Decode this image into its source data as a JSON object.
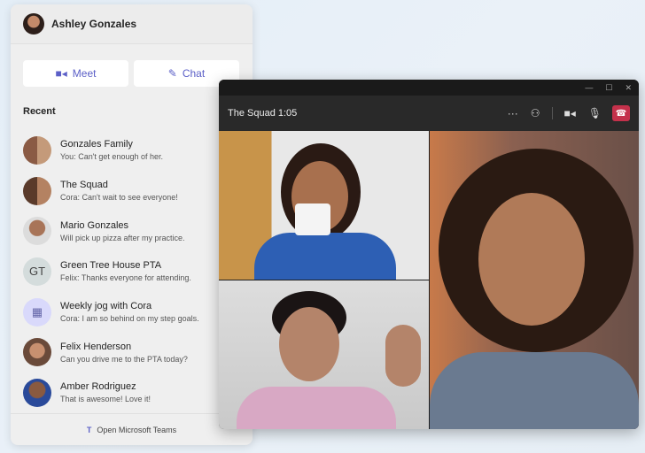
{
  "user": {
    "name": "Ashley Gonzales"
  },
  "actions": {
    "meet": "Meet",
    "chat": "Chat"
  },
  "recent_label": "Recent",
  "chats": [
    {
      "name": "Gonzales Family",
      "msg": "You: Can't get enough of her."
    },
    {
      "name": "The Squad",
      "msg": "Cora: Can't wait to see everyone!"
    },
    {
      "name": "Mario Gonzales",
      "msg": "Will pick up pizza after my practice."
    },
    {
      "name": "Green Tree House PTA",
      "msg": "Felix: Thanks everyone for attending.",
      "initials": "GT"
    },
    {
      "name": "Weekly jog with Cora",
      "msg": "Cora: I am so behind on my step goals."
    },
    {
      "name": "Felix Henderson",
      "msg": "Can you drive me to the PTA today?"
    },
    {
      "name": "Amber Rodriguez",
      "msg": "That is awesome! Love it!"
    }
  ],
  "footer": "Open Microsoft Teams",
  "call": {
    "title": "The Squad 1:05",
    "hangup_color": "#c4314b"
  }
}
